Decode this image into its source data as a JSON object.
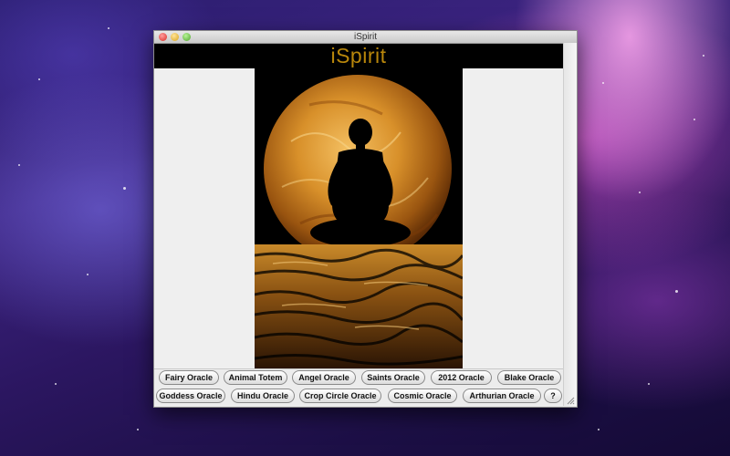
{
  "window": {
    "title": "iSpirit"
  },
  "banner": {
    "title": "iSpirit"
  },
  "image": {
    "name": "meditation-moon-image"
  },
  "buttons_row1": [
    {
      "label": "Fairy Oracle"
    },
    {
      "label": "Animal Totem"
    },
    {
      "label": "Angel Oracle"
    },
    {
      "label": "Saints Oracle"
    },
    {
      "label": "2012 Oracle"
    },
    {
      "label": "Blake Oracle"
    }
  ],
  "buttons_row2": [
    {
      "label": "Goddess Oracle"
    },
    {
      "label": "Hindu Oracle"
    },
    {
      "label": "Crop Circle Oracle"
    },
    {
      "label": "Cosmic Oracle"
    },
    {
      "label": "Arthurian Oracle"
    },
    {
      "label": "?"
    }
  ],
  "colors": {
    "banner_text": "#b8860b",
    "banner_bg": "#000000",
    "moon": "#d8902a"
  }
}
